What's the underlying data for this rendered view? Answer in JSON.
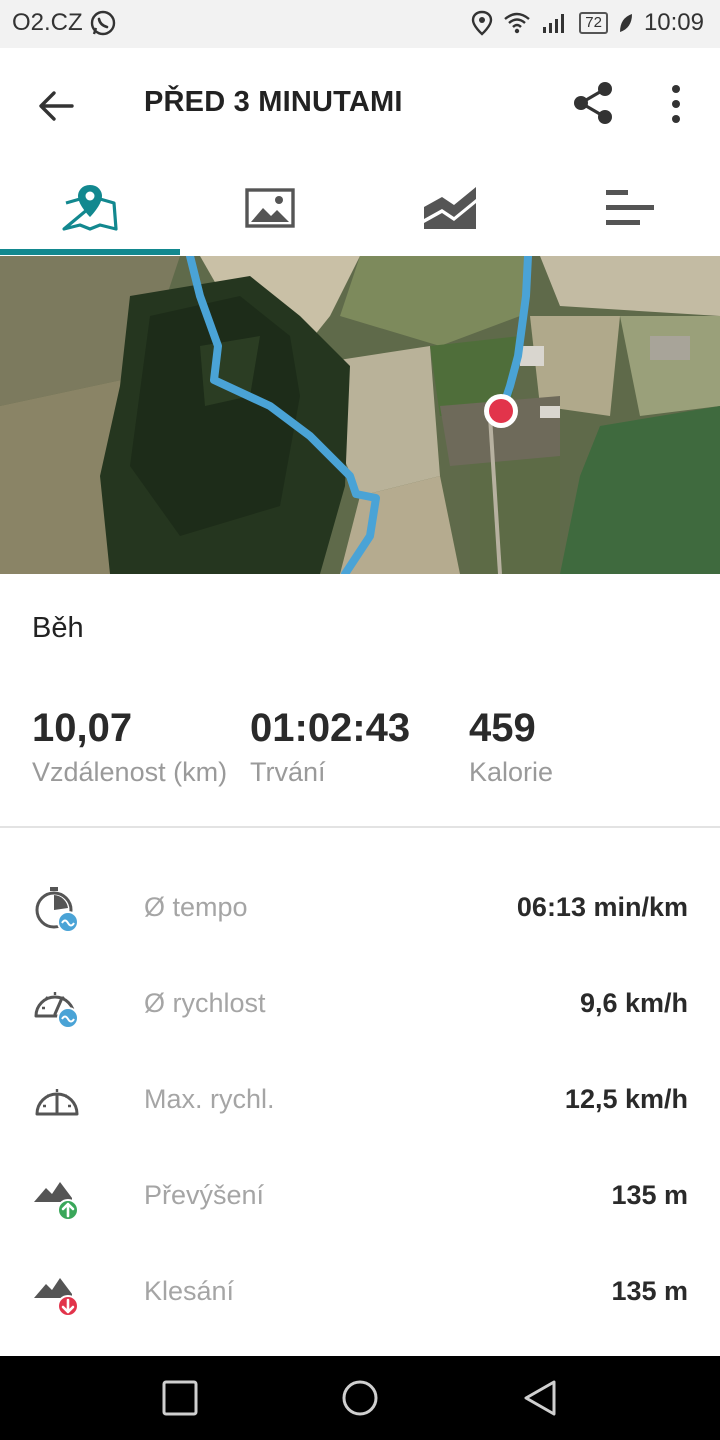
{
  "status_bar": {
    "carrier": "O2.CZ",
    "battery": "72",
    "time": "10:09"
  },
  "app_bar": {
    "title": "PŘED 3 MINUTAMI"
  },
  "tabs": [
    {
      "name": "map",
      "icon": "map-pin-icon",
      "selected": true
    },
    {
      "name": "photos",
      "icon": "image-icon",
      "selected": false
    },
    {
      "name": "charts",
      "icon": "area-chart-icon",
      "selected": false
    },
    {
      "name": "details",
      "icon": "bars-icon",
      "selected": false
    }
  ],
  "colors": {
    "accent": "#12888f",
    "route": "#4aa3d6",
    "marker": "#e2344b",
    "up": "#3aa75a",
    "down": "#e2344b"
  },
  "activity": {
    "type": "Běh"
  },
  "summary": [
    {
      "value": "10,07",
      "label": "Vzdálenost (km)"
    },
    {
      "value": "01:02:43",
      "label": "Trvání"
    },
    {
      "value": "459",
      "label": "Kalorie"
    }
  ],
  "metrics": [
    {
      "icon": "avg-pace-icon",
      "label": "Ø tempo",
      "value": "06:13 min/km"
    },
    {
      "icon": "avg-speed-icon",
      "label": "Ø rychlost",
      "value": "9,6 km/h"
    },
    {
      "icon": "max-speed-icon",
      "label": "Max. rychl.",
      "value": "12,5 km/h"
    },
    {
      "icon": "elevation-gain-icon",
      "label": "Převýšení",
      "value": "135 m"
    },
    {
      "icon": "elevation-loss-icon",
      "label": "Klesání",
      "value": "135 m"
    }
  ]
}
